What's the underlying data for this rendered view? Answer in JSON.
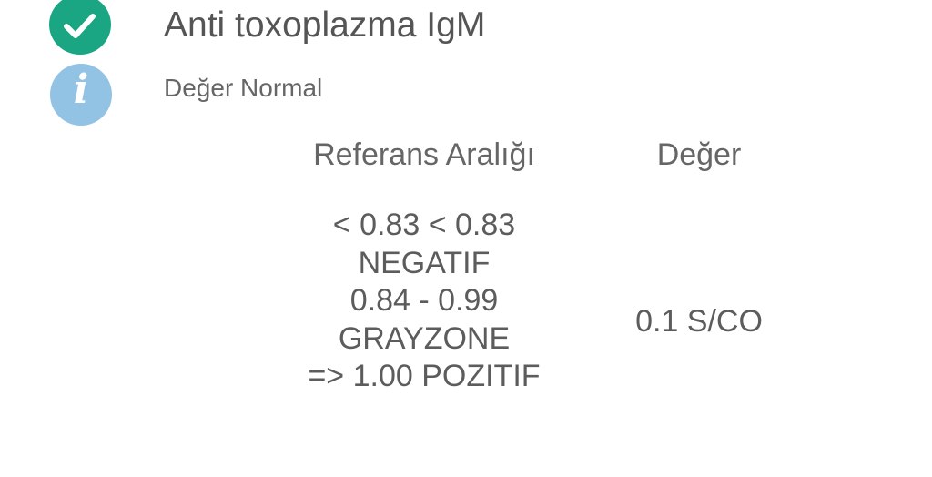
{
  "test": {
    "title": "Anti toxoplazma IgM",
    "status_text": "Değer Normal",
    "status_icon": "check-circle-icon",
    "info_icon": "info-icon",
    "info_glyph": "i",
    "colors": {
      "success": "#1aa683",
      "info": "#92c2e4"
    }
  },
  "table": {
    "headers": {
      "reference": "Referans Aralığı",
      "value": "Değer"
    },
    "reference_lines": [
      "< 0.83 < 0.83",
      "NEGATIF",
      "0.84 - 0.99",
      "GRAYZONE",
      "=> 1.00 POZITIF"
    ],
    "value": "0.1 S/CO"
  }
}
